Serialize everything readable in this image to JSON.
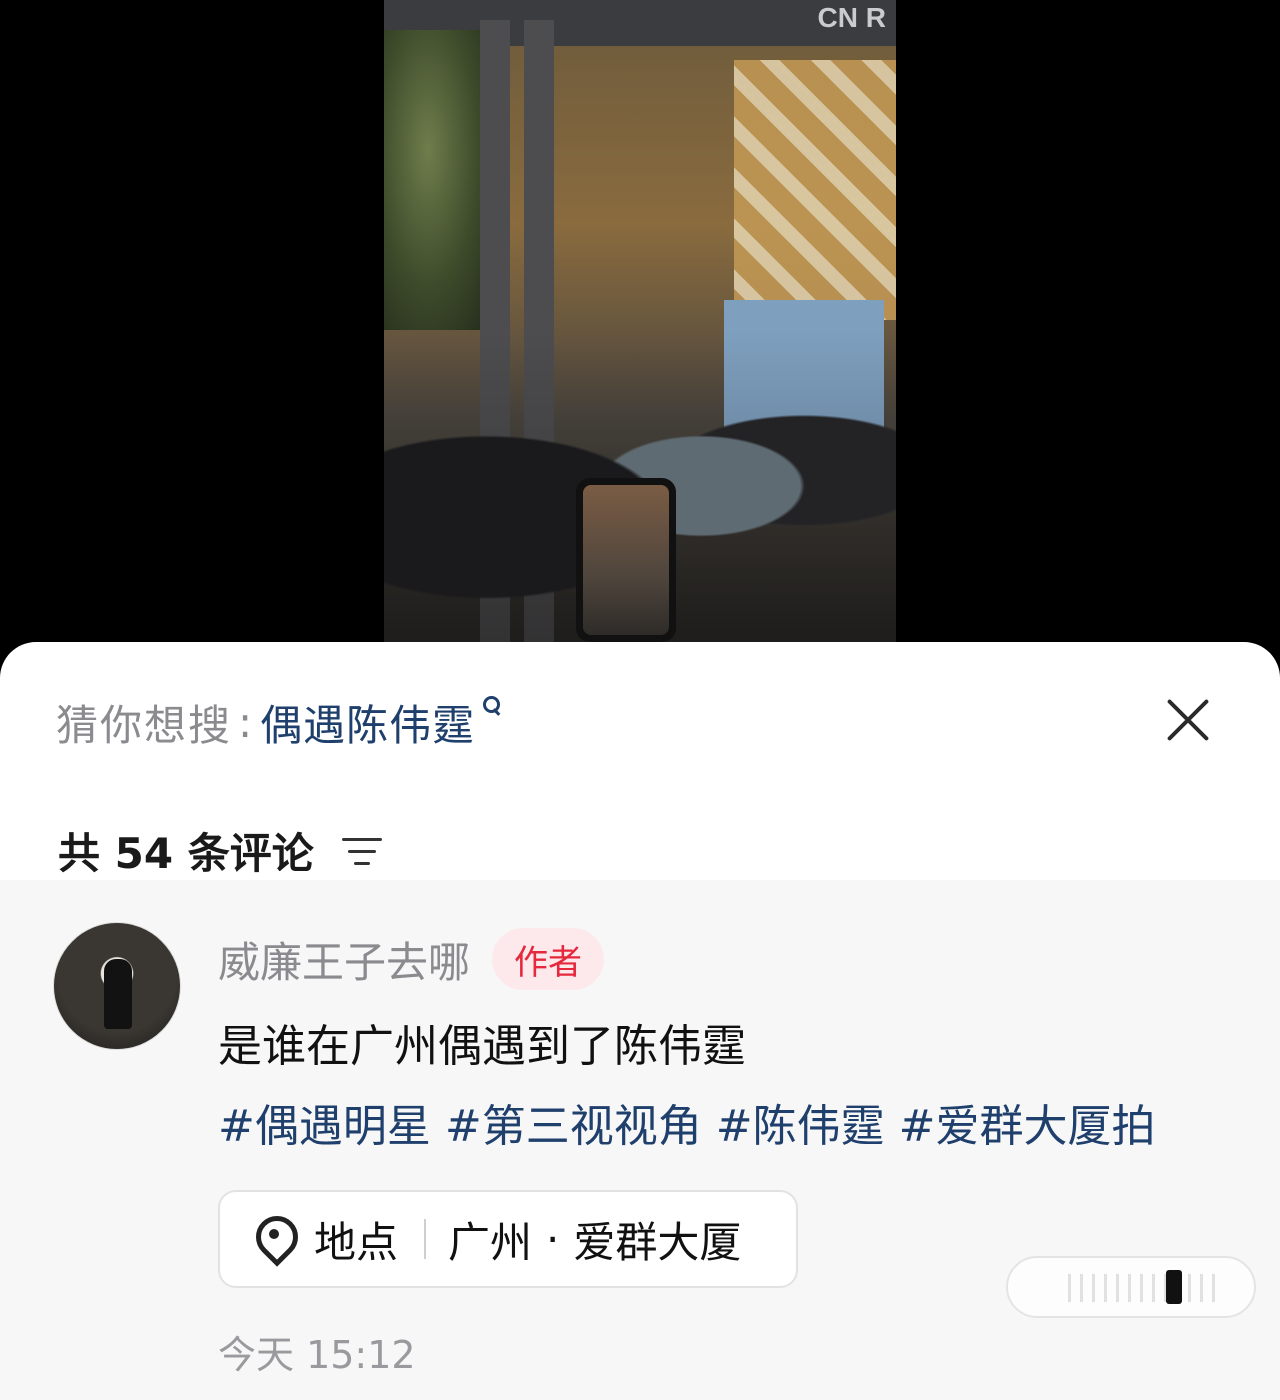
{
  "video": {
    "sign_text": "CN R"
  },
  "search_suggestion": {
    "label": "猜你想搜",
    "separator": ":",
    "query": "偶遇陈伟霆"
  },
  "comments_header": {
    "title": "共 54 条评论"
  },
  "comment": {
    "author_name": "威廉王子去哪",
    "author_badge": "作者",
    "text": "是谁在广州偶遇到了陈伟霆",
    "tags": [
      "#偶遇明星",
      "#第三视视角",
      "#陈伟霆",
      "#爱群大厦拍"
    ],
    "location": {
      "label": "地点",
      "city": "广州",
      "dot": "·",
      "place": "爱群大厦"
    },
    "timestamp": "今天 15:12"
  },
  "colors": {
    "link_blue": "#1f3f6c",
    "badge_red": "#e5283c",
    "badge_bg": "#fde9ec",
    "muted_gray": "#8a8a8f"
  },
  "icons": {
    "search": "search-icon",
    "close": "close-icon",
    "sort": "sort-icon",
    "location": "location-pin-icon"
  }
}
